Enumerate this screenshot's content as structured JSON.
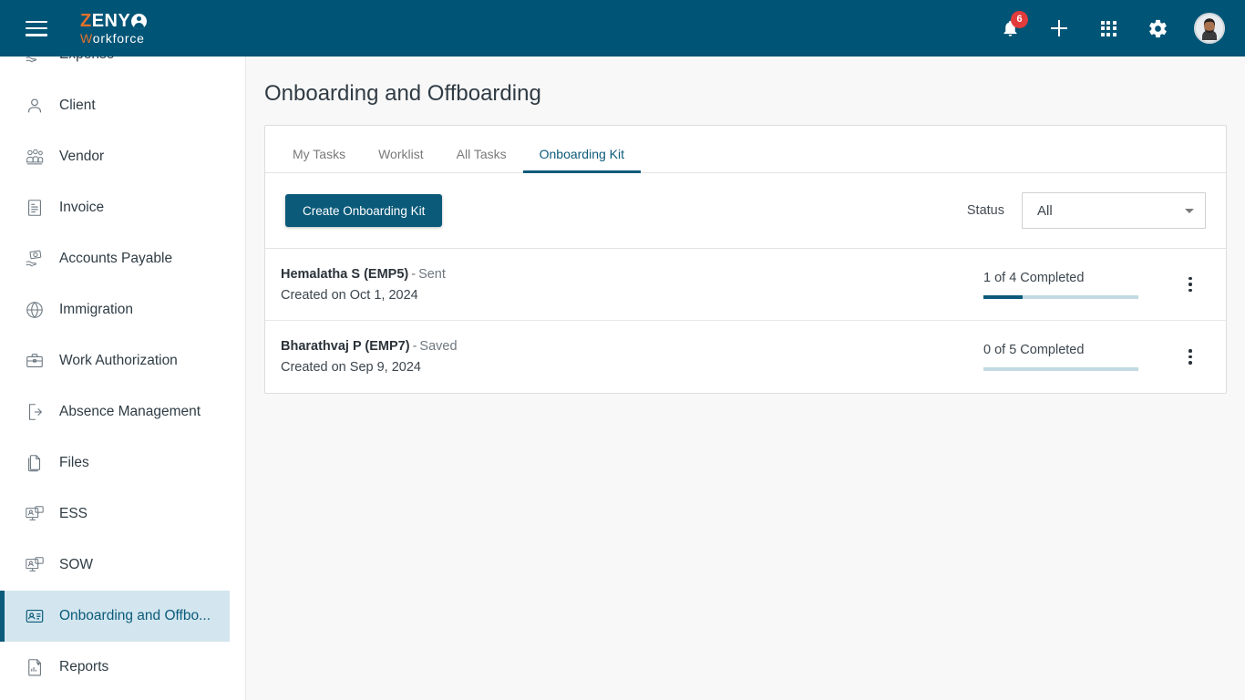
{
  "header": {
    "menu_icon": "hamburger-icon",
    "brand": {
      "z": "Z",
      "eny": "ENY",
      "w": "W",
      "orkforce": "orkforce"
    },
    "notifications": {
      "icon": "bell-icon",
      "badge": "6"
    },
    "add": {
      "icon": "plus-icon"
    },
    "apps": {
      "icon": "grid-apps-icon"
    },
    "settings": {
      "icon": "gear-icon"
    },
    "profile": {
      "icon": "avatar"
    },
    "bg_color": "#005476",
    "accent_color": "#e2712b"
  },
  "sidebar": {
    "items": [
      {
        "label": "Expense",
        "icon": "expense-icon",
        "active": false
      },
      {
        "label": "Client",
        "icon": "client-icon",
        "active": false
      },
      {
        "label": "Vendor",
        "icon": "vendor-icon",
        "active": false
      },
      {
        "label": "Invoice",
        "icon": "invoice-icon",
        "active": false
      },
      {
        "label": "Accounts Payable",
        "icon": "accounts-payable-icon",
        "active": false
      },
      {
        "label": "Immigration",
        "icon": "immigration-icon",
        "active": false
      },
      {
        "label": "Work Authorization",
        "icon": "work-authorization-icon",
        "active": false
      },
      {
        "label": "Absence Management",
        "icon": "absence-management-icon",
        "active": false
      },
      {
        "label": "Files",
        "icon": "files-icon",
        "active": false
      },
      {
        "label": "ESS",
        "icon": "ess-icon",
        "active": false
      },
      {
        "label": "SOW",
        "icon": "sow-icon",
        "active": false
      },
      {
        "label": "Onboarding and Offbo...",
        "icon": "onboarding-icon",
        "active": true
      },
      {
        "label": "Reports",
        "icon": "reports-icon",
        "active": false
      }
    ],
    "active_color": "#0b5a7a",
    "active_bg": "#d3e6ef"
  },
  "main": {
    "page_title": "Onboarding and Offboarding",
    "tabs": [
      {
        "label": "My Tasks",
        "active": false
      },
      {
        "label": "Worklist",
        "active": false
      },
      {
        "label": "All Tasks",
        "active": false
      },
      {
        "label": "Onboarding Kit",
        "active": true
      }
    ],
    "toolbar": {
      "create_button": "Create Onboarding Kit",
      "status_label": "Status",
      "status_value": "All",
      "status_options": [
        "All"
      ]
    },
    "kits": [
      {
        "name": "Hemalatha S (EMP5)",
        "dash": "-",
        "status": "Sent",
        "created": "Created on Oct 1, 2024",
        "progress_text": "1 of 4 Completed",
        "completed": 1,
        "total": 4,
        "menu_icon": "kebab-menu-icon"
      },
      {
        "name": "Bharathvaj P (EMP7)",
        "dash": "-",
        "status": "Saved",
        "created": "Created on Sep 9, 2024",
        "progress_text": "0 of 5 Completed",
        "completed": 0,
        "total": 5,
        "menu_icon": "kebab-menu-icon"
      }
    ]
  }
}
